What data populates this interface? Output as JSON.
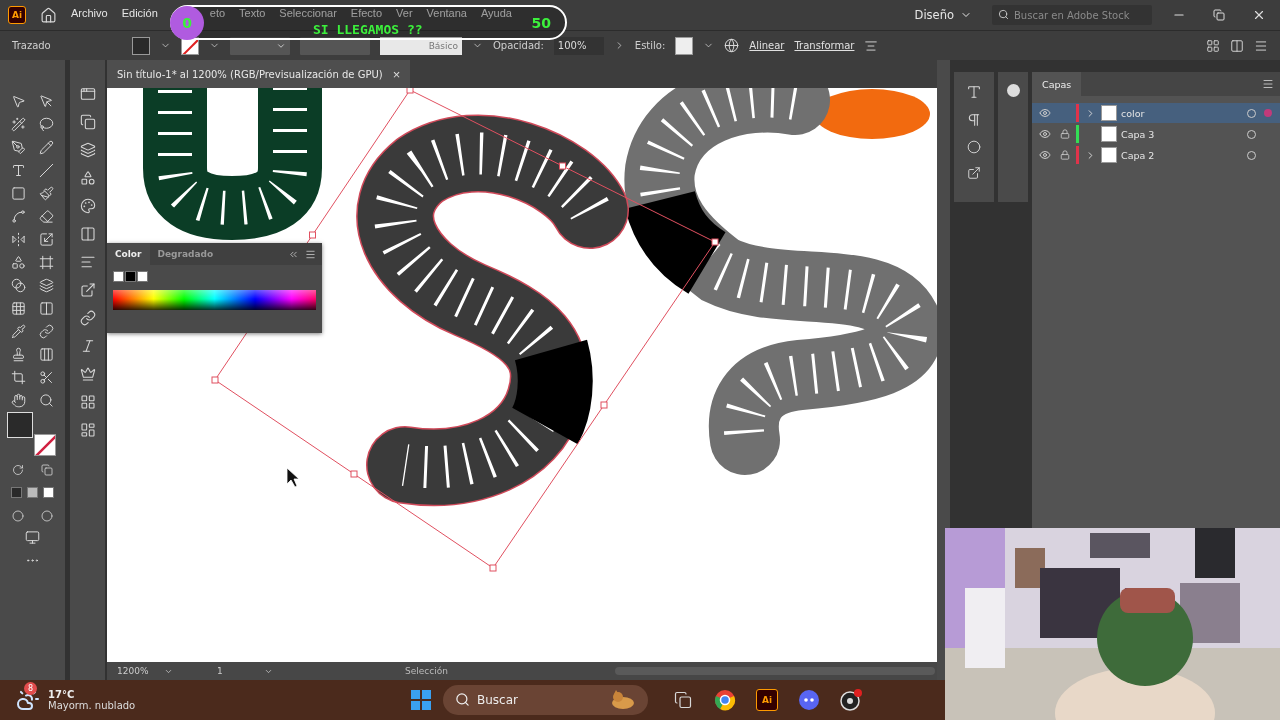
{
  "menu_bar": {
    "logo": "Ai",
    "items": [
      "Archivo",
      "Edición",
      "eto",
      "Texto",
      "Seleccionar",
      "Efecto",
      "Ver",
      "Ventana",
      "Ayuda"
    ],
    "workspace": "Diseño",
    "search": {
      "placeholder": "Buscar en Adobe Stock"
    }
  },
  "stream_overlay": {
    "count": "0",
    "text": "SI LLEGAMOS ??",
    "goal": "50"
  },
  "control_bar": {
    "selection_label": "Trazado",
    "stroke_profile": "Básico",
    "opacity_label": "Opacidad:",
    "opacity": "100%",
    "style_label": "Estilo:",
    "links": [
      "Alinear",
      "Transformar"
    ]
  },
  "document_tab": {
    "title": "Sin título-1* al 1200% (RGB/Previsualización de GPU)",
    "close": "×"
  },
  "color_panel": {
    "tabs": [
      {
        "label": "Color",
        "selected": true
      },
      {
        "label": "Degradado",
        "selected": false
      }
    ]
  },
  "layers_panel": {
    "tabs": [
      {
        "label": "Capas",
        "selected": true
      }
    ],
    "layers": [
      {
        "name": "color",
        "selected": true,
        "visible": true,
        "locked": false,
        "expandable": true,
        "color": "#e0334a"
      },
      {
        "name": "Capa 3",
        "selected": false,
        "visible": true,
        "locked": true,
        "expandable": false,
        "color": "#33dd55"
      },
      {
        "name": "Capa 2",
        "selected": false,
        "visible": true,
        "locked": true,
        "expandable": true,
        "color": "#e0334a"
      }
    ]
  },
  "status_bar": {
    "zoom": "1200%",
    "artboard": "1",
    "tool": "Selección"
  },
  "taskbar": {
    "weather": {
      "badge": "8",
      "temperature": "17°C",
      "condition": "Mayorm. nublado"
    },
    "search": {
      "placeholder": "Buscar"
    },
    "app_label": "Ai"
  }
}
